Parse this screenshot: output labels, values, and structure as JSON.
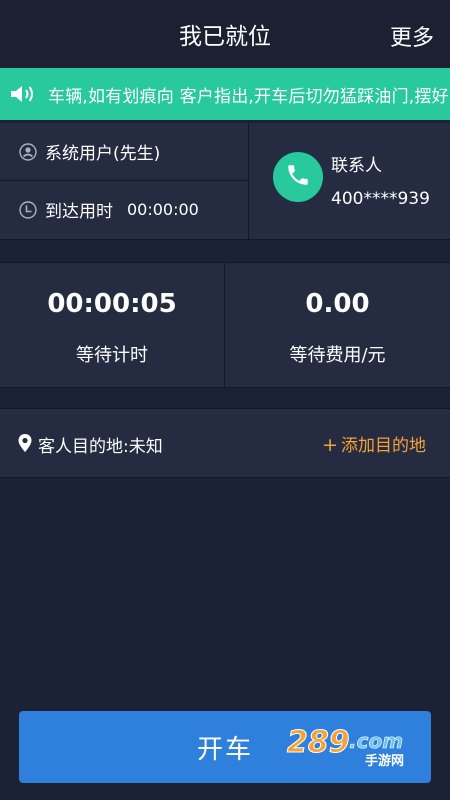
{
  "header": {
    "title": "我已就位",
    "more_label": "更多"
  },
  "notice": {
    "text": "车辆,如有划痕向 客户指出,开车后切勿猛踩油门,摆好"
  },
  "passenger": {
    "name": "系统用户(先生)",
    "arrival_label": "到达用时",
    "arrival_time": "00:00:00"
  },
  "contact": {
    "label": "联系人",
    "phone": "400****939"
  },
  "stats": [
    {
      "value": "00:00:05",
      "label": "等待计时"
    },
    {
      "value": "0.00",
      "label": "等待费用/元"
    }
  ],
  "destination": {
    "text": "客人目的地:未知",
    "add_label": "添加目的地"
  },
  "start_button": {
    "label": "开车"
  },
  "watermark": {
    "main": "289",
    "suffix": ".com",
    "sub": "手游网"
  },
  "colors": {
    "accent_green": "#27c99d",
    "accent_orange": "#f4a233",
    "button_blue": "#2f7fdc",
    "background": "#1c2236",
    "panel": "#252b40"
  },
  "icons": {
    "speaker": "speaker-icon",
    "user": "user-icon",
    "clock": "clock-icon",
    "phone": "phone-icon",
    "pin": "location-pin-icon"
  }
}
